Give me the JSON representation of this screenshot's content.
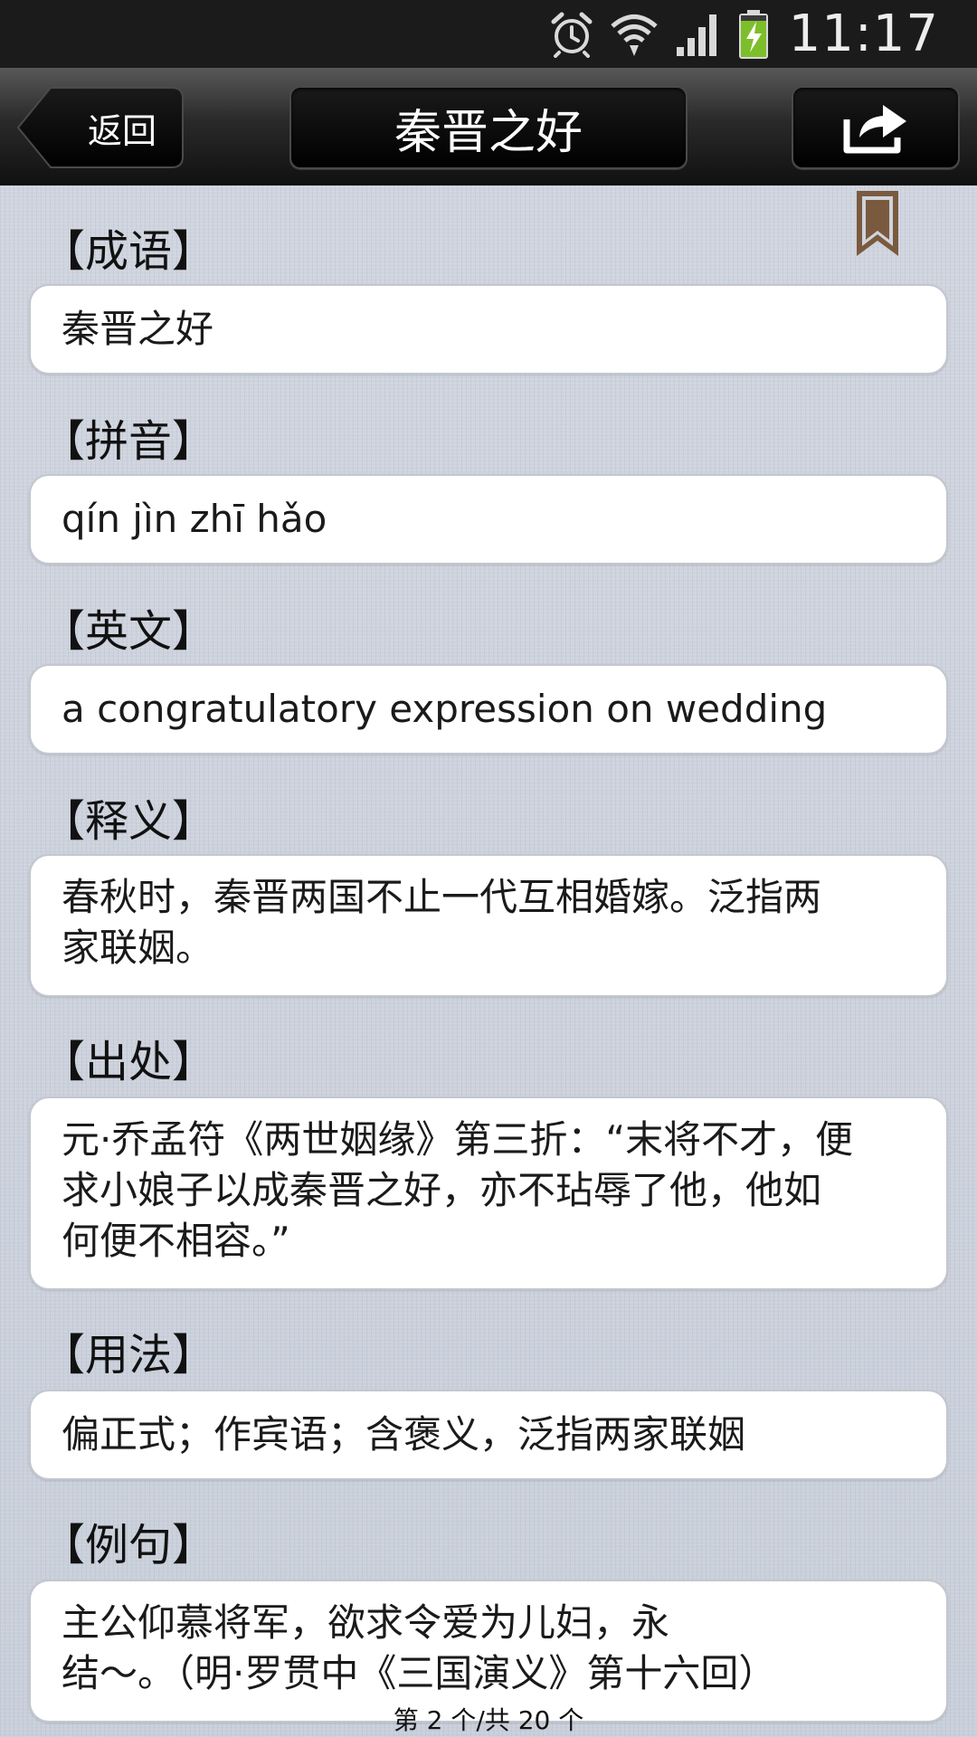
{
  "status_bar": {
    "time": "11:17",
    "icons": [
      "alarm-icon",
      "wifi-icon",
      "signal-icon",
      "battery-charging-icon"
    ]
  },
  "nav": {
    "back_label": "返回",
    "title": "秦晋之好",
    "share_icon": "share-icon"
  },
  "bookmark_icon": "bookmark-icon",
  "sections": {
    "idiom": {
      "heading": "【成语】",
      "body": "秦晋之好"
    },
    "pinyin": {
      "heading": "【拼音】",
      "body": "qín jìn zhī hǎo"
    },
    "english": {
      "heading": "【英文】",
      "body": "a congratulatory expression on wedding"
    },
    "meaning": {
      "heading": "【释义】",
      "body": "春秋时，秦晋两国不止一代互相婚嫁。泛指两\n家联姻。"
    },
    "source": {
      "heading": "【出处】",
      "body": "元·乔孟符《两世姻缘》第三折：“末将不才，便\n求小娘子以成秦晋之好，亦不玷辱了他，他如\n何便不相容。”"
    },
    "usage": {
      "heading": "【用法】",
      "body": "偏正式；作宾语；含褒义，泛指两家联姻"
    },
    "example": {
      "heading": "【例句】",
      "body": "主公仰慕将军，欲求令爱为儿妇，永\n结～。（明·罗贯中《三国演义》第十六回）"
    }
  },
  "pager": "第 2 个/共 20 个"
}
